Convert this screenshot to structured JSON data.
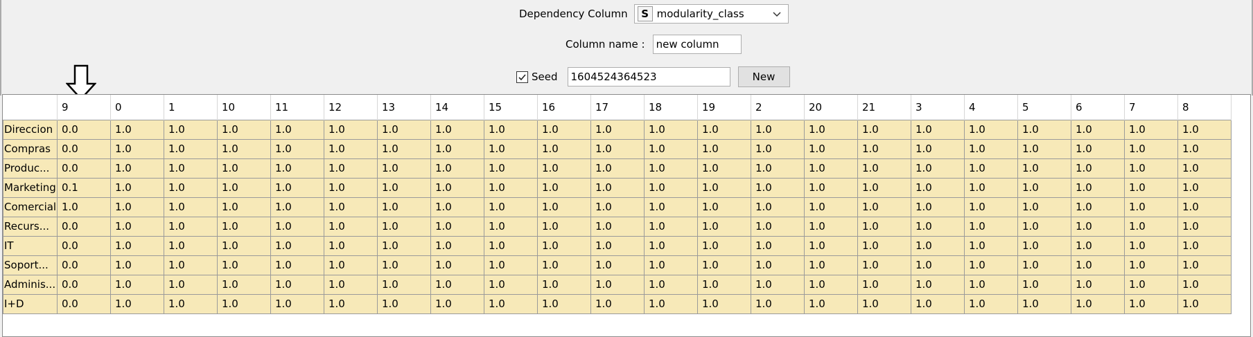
{
  "dependency": {
    "label": "Dependency Column",
    "type_badge": "S",
    "value": "modularity_class"
  },
  "column_name": {
    "label": "Column name :",
    "value": "new column"
  },
  "seed": {
    "label": "Seed",
    "checked": true,
    "value": "1604524364523",
    "new_button": "New"
  },
  "table": {
    "columns": [
      "",
      "9",
      "0",
      "1",
      "10",
      "11",
      "12",
      "13",
      "14",
      "15",
      "16",
      "17",
      "18",
      "19",
      "2",
      "20",
      "21",
      "3",
      "4",
      "5",
      "6",
      "7",
      "8"
    ],
    "rows": [
      {
        "name": "Direccion",
        "values": [
          "0.0",
          "1.0",
          "1.0",
          "1.0",
          "1.0",
          "1.0",
          "1.0",
          "1.0",
          "1.0",
          "1.0",
          "1.0",
          "1.0",
          "1.0",
          "1.0",
          "1.0",
          "1.0",
          "1.0",
          "1.0",
          "1.0",
          "1.0",
          "1.0",
          "1.0"
        ]
      },
      {
        "name": "Compras",
        "values": [
          "0.0",
          "1.0",
          "1.0",
          "1.0",
          "1.0",
          "1.0",
          "1.0",
          "1.0",
          "1.0",
          "1.0",
          "1.0",
          "1.0",
          "1.0",
          "1.0",
          "1.0",
          "1.0",
          "1.0",
          "1.0",
          "1.0",
          "1.0",
          "1.0",
          "1.0"
        ]
      },
      {
        "name": "Produc...",
        "values": [
          "0.0",
          "1.0",
          "1.0",
          "1.0",
          "1.0",
          "1.0",
          "1.0",
          "1.0",
          "1.0",
          "1.0",
          "1.0",
          "1.0",
          "1.0",
          "1.0",
          "1.0",
          "1.0",
          "1.0",
          "1.0",
          "1.0",
          "1.0",
          "1.0",
          "1.0"
        ]
      },
      {
        "name": "Marketing",
        "values": [
          "0.1",
          "1.0",
          "1.0",
          "1.0",
          "1.0",
          "1.0",
          "1.0",
          "1.0",
          "1.0",
          "1.0",
          "1.0",
          "1.0",
          "1.0",
          "1.0",
          "1.0",
          "1.0",
          "1.0",
          "1.0",
          "1.0",
          "1.0",
          "1.0",
          "1.0"
        ]
      },
      {
        "name": "Comercial",
        "values": [
          "1.0",
          "1.0",
          "1.0",
          "1.0",
          "1.0",
          "1.0",
          "1.0",
          "1.0",
          "1.0",
          "1.0",
          "1.0",
          "1.0",
          "1.0",
          "1.0",
          "1.0",
          "1.0",
          "1.0",
          "1.0",
          "1.0",
          "1.0",
          "1.0",
          "1.0"
        ]
      },
      {
        "name": "Recurs...",
        "values": [
          "0.0",
          "1.0",
          "1.0",
          "1.0",
          "1.0",
          "1.0",
          "1.0",
          "1.0",
          "1.0",
          "1.0",
          "1.0",
          "1.0",
          "1.0",
          "1.0",
          "1.0",
          "1.0",
          "1.0",
          "1.0",
          "1.0",
          "1.0",
          "1.0",
          "1.0"
        ]
      },
      {
        "name": "IT",
        "values": [
          "0.0",
          "1.0",
          "1.0",
          "1.0",
          "1.0",
          "1.0",
          "1.0",
          "1.0",
          "1.0",
          "1.0",
          "1.0",
          "1.0",
          "1.0",
          "1.0",
          "1.0",
          "1.0",
          "1.0",
          "1.0",
          "1.0",
          "1.0",
          "1.0",
          "1.0"
        ]
      },
      {
        "name": "Soport...",
        "values": [
          "0.0",
          "1.0",
          "1.0",
          "1.0",
          "1.0",
          "1.0",
          "1.0",
          "1.0",
          "1.0",
          "1.0",
          "1.0",
          "1.0",
          "1.0",
          "1.0",
          "1.0",
          "1.0",
          "1.0",
          "1.0",
          "1.0",
          "1.0",
          "1.0",
          "1.0"
        ]
      },
      {
        "name": "Adminis...",
        "values": [
          "0.0",
          "1.0",
          "1.0",
          "1.0",
          "1.0",
          "1.0",
          "1.0",
          "1.0",
          "1.0",
          "1.0",
          "1.0",
          "1.0",
          "1.0",
          "1.0",
          "1.0",
          "1.0",
          "1.0",
          "1.0",
          "1.0",
          "1.0",
          "1.0",
          "1.0"
        ]
      },
      {
        "name": "I+D",
        "values": [
          "0.0",
          "1.0",
          "1.0",
          "1.0",
          "1.0",
          "1.0",
          "1.0",
          "1.0",
          "1.0",
          "1.0",
          "1.0",
          "1.0",
          "1.0",
          "1.0",
          "1.0",
          "1.0",
          "1.0",
          "1.0",
          "1.0",
          "1.0",
          "1.0",
          "1.0"
        ]
      }
    ]
  },
  "icons": {
    "dropdown": "chevron-down-icon",
    "checkbox": "checkmark-icon",
    "annotation": "down-arrow-icon"
  },
  "colors": {
    "cell_fill": "#f7e9b8",
    "grid_line": "#9a9a9a",
    "panel_bg": "#f0f0f0"
  }
}
